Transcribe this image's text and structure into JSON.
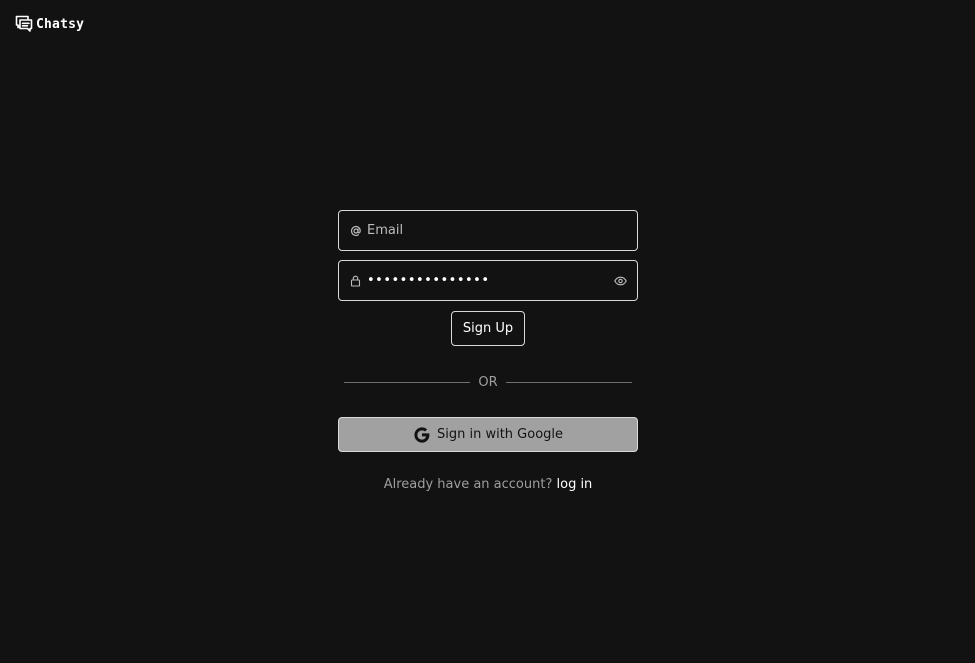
{
  "brand": {
    "name": "Chatsy",
    "icon": "chat-bubble-icon"
  },
  "form": {
    "email": {
      "placeholder": "Email",
      "value": "",
      "icon": "at-sign-icon"
    },
    "password": {
      "value": "•••••••••••••••",
      "icon": "lock-icon",
      "toggle_icon": "eye-icon"
    },
    "signup_label": "Sign Up",
    "divider_label": "OR",
    "google_label": "Sign in with Google",
    "google_icon": "google-g-icon",
    "footer_prompt": "Already have an account?",
    "footer_link": "log in"
  },
  "colors": {
    "background": "#121212",
    "border": "#d9d9d9",
    "muted_text": "#9e9e9e",
    "google_button_bg": "#a1a1a1"
  }
}
